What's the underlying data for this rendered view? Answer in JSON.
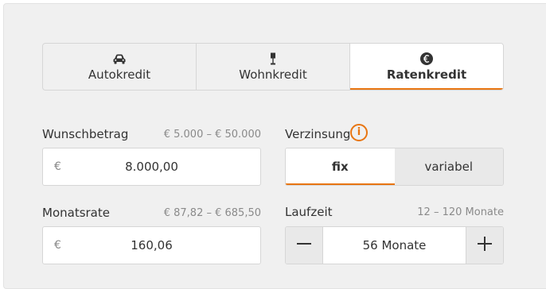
{
  "tabs": [
    {
      "label": "Autokredit",
      "icon": "car-icon",
      "active": false
    },
    {
      "label": "Wohnkredit",
      "icon": "lamp-icon",
      "active": false
    },
    {
      "label": "Ratenkredit",
      "icon": "euro-coin-icon",
      "active": true
    }
  ],
  "wunschbetrag": {
    "label": "Wunschbetrag",
    "range": "€ 5.000 – € 50.000",
    "currency": "€",
    "value": "8.000,00"
  },
  "verzinsung": {
    "label": "Verzinsung",
    "info": "i",
    "options": [
      "fix",
      "variabel"
    ],
    "selected": "fix"
  },
  "monatsrate": {
    "label": "Monatsrate",
    "range": "€ 87,82 – € 685,50",
    "currency": "€",
    "value": "160,06"
  },
  "laufzeit": {
    "label": "Laufzeit",
    "range": "12 – 120 Monate",
    "value": "56 Monate"
  },
  "colors": {
    "accent": "#e87511",
    "panel": "#f0f0f0",
    "border": "#d6d6d6"
  }
}
